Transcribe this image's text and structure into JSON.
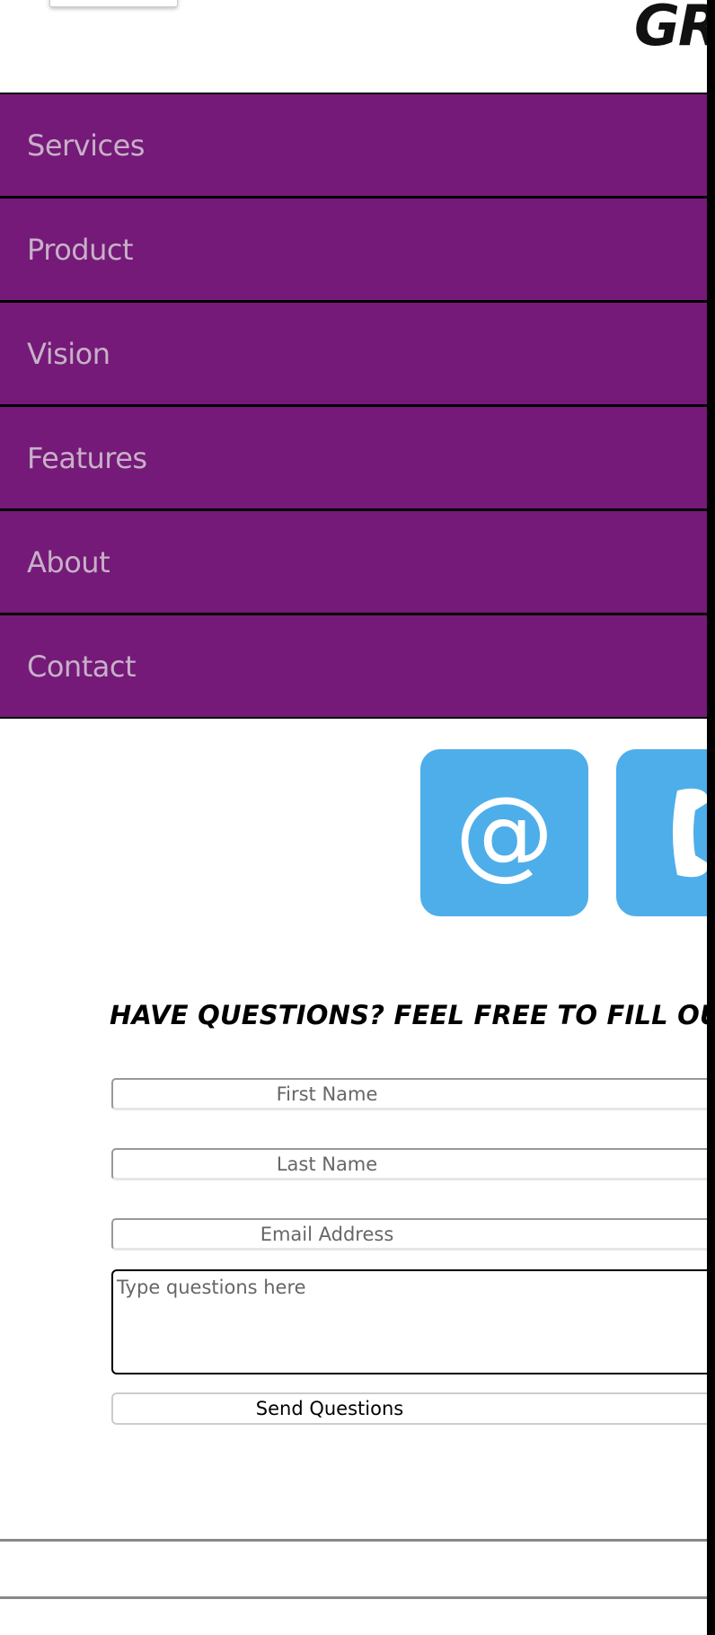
{
  "header": {
    "logo_text": "GR"
  },
  "nav": {
    "items": [
      {
        "label": "Services"
      },
      {
        "label": "Product"
      },
      {
        "label": "Vision"
      },
      {
        "label": "Features"
      },
      {
        "label": "About"
      },
      {
        "label": "Contact"
      }
    ]
  },
  "contact_icons": {
    "email_symbol": "@",
    "phone_icon": "phone-icon"
  },
  "form": {
    "heading": "HAVE QUESTIONS? FEEL FREE TO FILL OUT THE FORM BEL",
    "first_name_placeholder": "First Name",
    "last_name_placeholder": "Last Name",
    "email_placeholder": "Email Address",
    "questions_placeholder": "Type questions here",
    "submit_label": "Send Questions"
  },
  "colors": {
    "nav_background": "#751a78",
    "nav_text": "#c7b0c8",
    "icon_tile": "#4eaee9"
  }
}
